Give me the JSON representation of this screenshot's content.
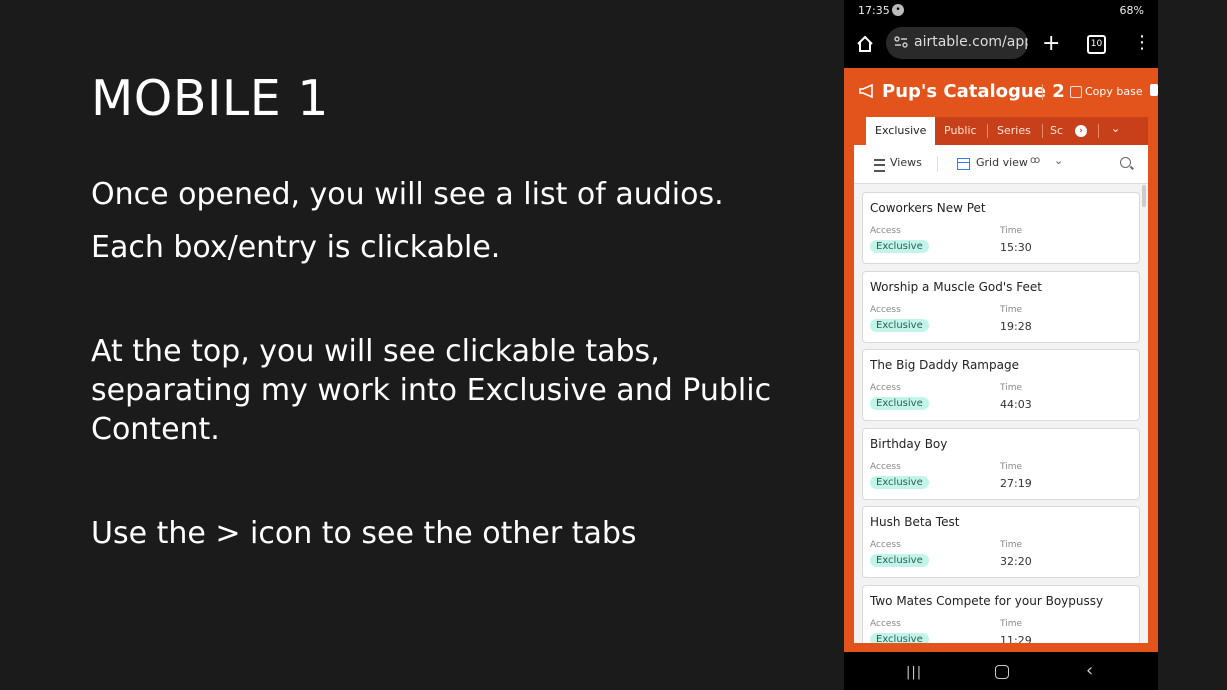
{
  "slide": {
    "title": "MOBILE 1",
    "paragraphs": [
      "Once opened, you will see a list of audios.",
      "Each box/entry is clickable.",
      "At the top, you will see clickable tabs, separating my work into Exclusive and Public Content.",
      "Use the > icon to see the other tabs"
    ]
  },
  "phone": {
    "status": {
      "time": "17:35",
      "battery": "68%"
    },
    "browser": {
      "url": "airtable.com/app",
      "tab_count": "10"
    },
    "base": {
      "title": "Pup's Catalogue 2",
      "copy_label": "Copy base",
      "tabs": [
        "Exclusive",
        "Public",
        "Series",
        "Sc"
      ],
      "active_tab": "Exclusive",
      "views_label": "Views",
      "view_name": "Grid view"
    },
    "field_labels": {
      "access": "Access",
      "time": "Time"
    },
    "records": [
      {
        "name": "Coworkers New Pet",
        "access": "Exclusive",
        "time": "15:30"
      },
      {
        "name": "Worship a Muscle God's Feet",
        "access": "Exclusive",
        "time": "19:28"
      },
      {
        "name": "The Big Daddy Rampage",
        "access": "Exclusive",
        "time": "44:03"
      },
      {
        "name": "Birthday Boy",
        "access": "Exclusive",
        "time": "27:19"
      },
      {
        "name": "Hush Beta Test",
        "access": "Exclusive",
        "time": "32:20"
      },
      {
        "name": "Two Mates Compete for your Boypussy",
        "access": "Exclusive",
        "time": "11:29"
      }
    ]
  },
  "colors": {
    "accent": "#e2541b",
    "tabbar": "#c8401a",
    "badge": "#c2f5e9"
  }
}
